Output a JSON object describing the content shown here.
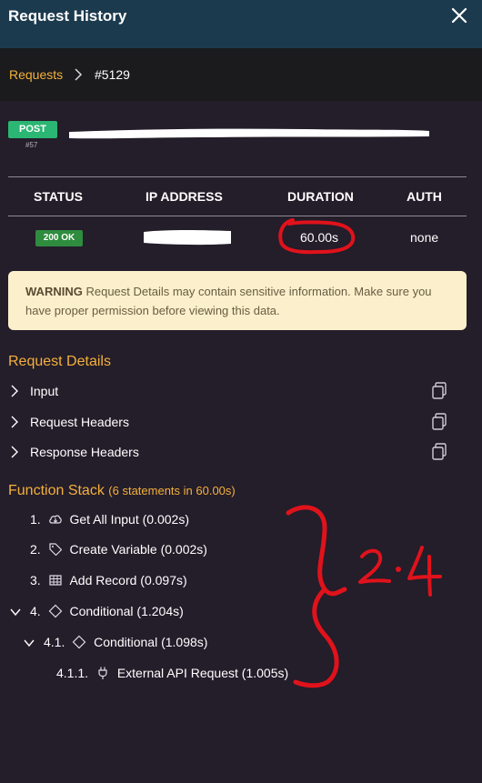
{
  "titlebar": {
    "title": "Request History",
    "close_icon": "close-icon"
  },
  "breadcrumb": {
    "link": "Requests",
    "separator_icon": "chevron-right-icon",
    "current": "#5129"
  },
  "request": {
    "method": "POST",
    "number": "#57"
  },
  "stats": {
    "headers": [
      "STATUS",
      "IP ADDRESS",
      "DURATION",
      "AUTH"
    ],
    "status": "200 OK",
    "duration": "60.00s",
    "auth": "none"
  },
  "warning": {
    "label": "WARNING",
    "text": "Request Details may contain sensitive information. Make sure you have proper permission before viewing this data."
  },
  "request_details": {
    "title": "Request Details",
    "items": [
      {
        "label": "Input",
        "icon": "copy-icon"
      },
      {
        "label": "Request Headers",
        "icon": "copy-icon"
      },
      {
        "label": "Response Headers",
        "icon": "copy-icon"
      }
    ]
  },
  "function_stack": {
    "title": "Function Stack",
    "subtitle": "(6 statements in 60.00s)",
    "items": [
      {
        "num": "1.",
        "icon": "cloud-download-icon",
        "label": "Get All Input (0.002s)"
      },
      {
        "num": "2.",
        "icon": "tag-icon",
        "label": "Create Variable (0.002s)"
      },
      {
        "num": "3.",
        "icon": "table-icon",
        "label": "Add Record (0.097s)"
      },
      {
        "num": "4.",
        "icon": "diamond-icon",
        "label": "Conditional (1.204s)"
      },
      {
        "num": "4.1.",
        "icon": "diamond-icon",
        "label": "Conditional (1.098s)"
      },
      {
        "num": "4.1.1.",
        "icon": "plug-icon",
        "label": "External API Request (1.005s)"
      }
    ]
  },
  "annotation": {
    "text": "2.4",
    "color": "#e0121b"
  },
  "colors": {
    "accent": "#f4b13c",
    "titlebar": "#1c3a4e",
    "background": "#241d2a",
    "success": "#2bb673",
    "warning_bg": "#fbf0cb"
  }
}
